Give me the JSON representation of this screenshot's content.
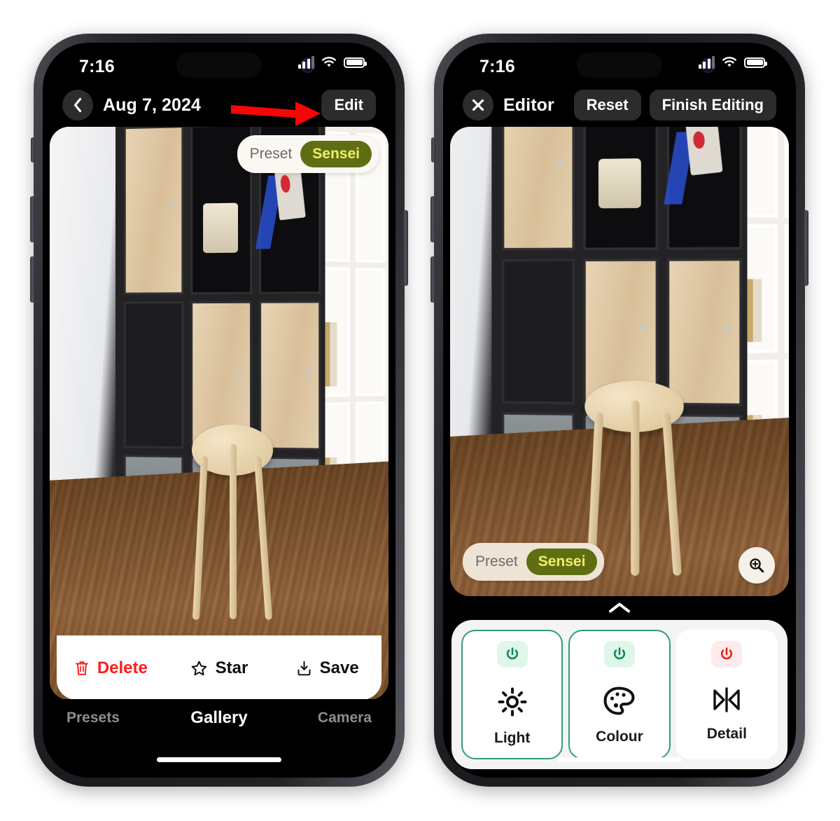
{
  "left_phone": {
    "status_bar": {
      "time": "7:16",
      "cellular_icon": "cellular-bars-icon",
      "wifi_icon": "wifi-icon",
      "battery_icon": "battery-full-icon"
    },
    "nav": {
      "back_icon": "chevron-left-icon",
      "title": "Aug 7, 2024",
      "edit_label": "Edit"
    },
    "preset": {
      "label": "Preset",
      "value": "Sensei"
    },
    "actions": [
      {
        "label": "Delete",
        "icon": "trash-icon",
        "style": "danger"
      },
      {
        "label": "Star",
        "icon": "star-icon",
        "style": "normal"
      },
      {
        "label": "Save",
        "icon": "save-download-icon",
        "style": "normal"
      }
    ],
    "tabs": [
      {
        "label": "Presets",
        "active": false
      },
      {
        "label": "Gallery",
        "active": true
      },
      {
        "label": "Camera",
        "active": false
      }
    ]
  },
  "right_phone": {
    "status_bar": {
      "time": "7:16",
      "cellular_icon": "cellular-bars-icon",
      "wifi_icon": "wifi-icon",
      "battery_icon": "battery-full-icon"
    },
    "nav": {
      "close_icon": "close-x-icon",
      "title": "Editor",
      "reset_label": "Reset",
      "finish_label": "Finish Editing"
    },
    "preset": {
      "label": "Preset",
      "value": "Sensei"
    },
    "zoom_button_icon": "magnifier-plus-icon",
    "handle_icon": "chevron-up-icon",
    "tools": [
      {
        "label": "Light",
        "glyph": "sun-icon",
        "power": "on",
        "selected": true
      },
      {
        "label": "Colour",
        "glyph": "palette-icon",
        "power": "on",
        "selected": true
      },
      {
        "label": "Detail",
        "glyph": "detail-icon",
        "power": "off",
        "selected": false
      }
    ]
  },
  "annotation": {
    "arrow_icon": "arrow-right-icon",
    "color": "#f60606"
  },
  "colors": {
    "accent_green": "#2f9e72",
    "preset_badge_bg": "#5f6e13",
    "preset_badge_text": "#f0ef6a",
    "danger_red": "#ff1d1d",
    "power_on": "#0f8a55",
    "power_off": "#ee1b1b"
  }
}
